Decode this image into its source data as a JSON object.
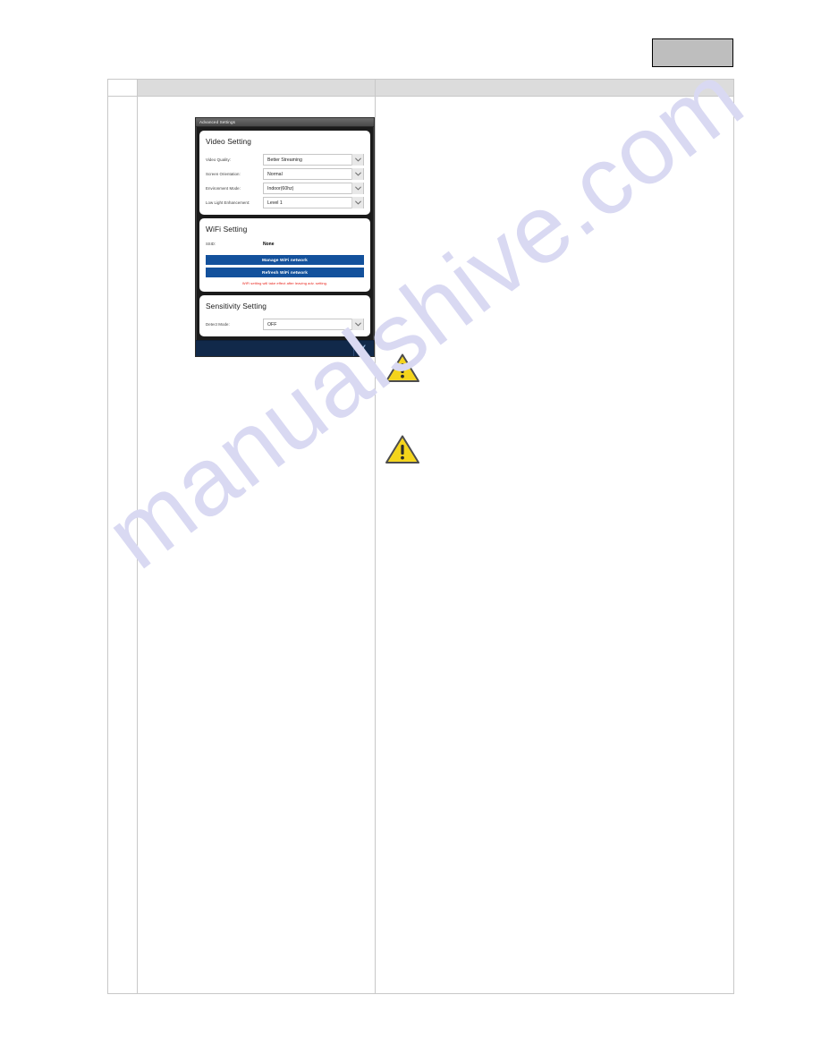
{
  "page": {
    "background_color": "#ffffff",
    "watermark_text": "manualshive.com",
    "watermark_color": "#d9d9f2"
  },
  "stamp_box": {
    "label": "",
    "fill_color": "#bebebe",
    "border_color": "#000000"
  },
  "table": {
    "header_cells": [
      "",
      "",
      ""
    ],
    "columns": [
      "",
      "",
      ""
    ]
  },
  "phone": {
    "titlebar": {
      "title": "Advanced Settings",
      "icon": "back-arrow-icon"
    },
    "video_setting": {
      "title": "Video Setting",
      "fields": [
        {
          "label": "Video Quality:",
          "value": "Better Streaming",
          "icon": "chevron-down-icon"
        },
        {
          "label": "Screen Orientation:",
          "value": "Normal",
          "icon": "chevron-down-icon"
        },
        {
          "label": "Environment Mode:",
          "value": "Indoor(60hz)",
          "icon": "chevron-down-icon"
        },
        {
          "label": "Low Light Enhancement:",
          "value": "Level 1",
          "icon": "chevron-down-icon"
        }
      ]
    },
    "wifi_setting": {
      "title": "WiFi Setting",
      "ssid_label": "SSID:",
      "ssid_value": "None",
      "manage_button": "Manage WiFi network",
      "refresh_button": "Refresh WiFi network",
      "note": "WiFi setting will take effect after leaving adv. setting.",
      "note_color": "#e8241c",
      "button_color": "#13519c"
    },
    "sensitivity_setting": {
      "title": "Sensitivity Setting",
      "fields": [
        {
          "label": "Detect Mode:",
          "value": "OFF",
          "icon": "chevron-down-icon"
        }
      ]
    },
    "bottom_bar": {
      "back_icon": "chevron-left-icon",
      "color": "#11294a"
    }
  },
  "notes": {
    "warning_1_icon": "warning-triangle-icon",
    "warning_2_icon": "warning-triangle-icon",
    "warning_color": "#f5d31e",
    "body_text_1": "",
    "body_text_2": ""
  }
}
